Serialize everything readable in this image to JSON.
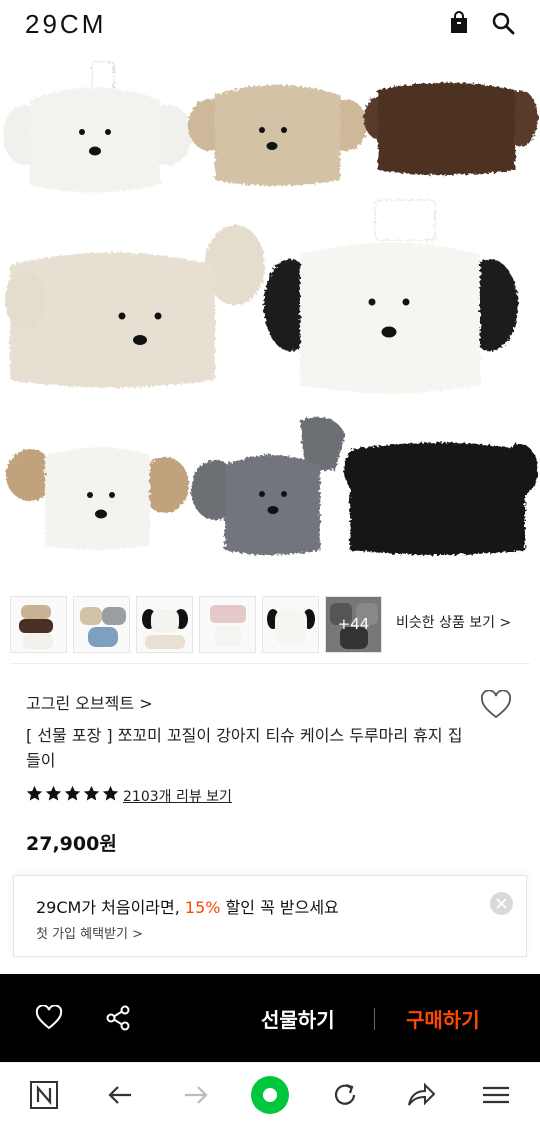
{
  "header": {
    "logo": "29CM",
    "bag_icon": "shopping-bag-icon",
    "search_icon": "search-icon"
  },
  "gallery": {
    "more_count": "+44",
    "similar_label": "비슷한 상품 보기 >"
  },
  "product": {
    "brand": "고그린 오브젝트 >",
    "title": "[ 선물 포장 ] 쪼꼬미 꼬질이 강아지 티슈 케이스 두루마리 휴지 집들이",
    "review_label": "2103개 리뷰 보기",
    "rating": 5,
    "price": "27,900원"
  },
  "promo": {
    "line_before": "29CM가 처음이라면, ",
    "line_accent": "15%",
    "line_after": " 할인 꼭 받으세요",
    "sub": "첫 가입 혜택받기 >"
  },
  "actions": {
    "gift": "선물하기",
    "buy": "구매하기"
  },
  "colors": {
    "accent": "#ff4800",
    "action_bar": "#000000",
    "browser_home": "#00c73c"
  }
}
